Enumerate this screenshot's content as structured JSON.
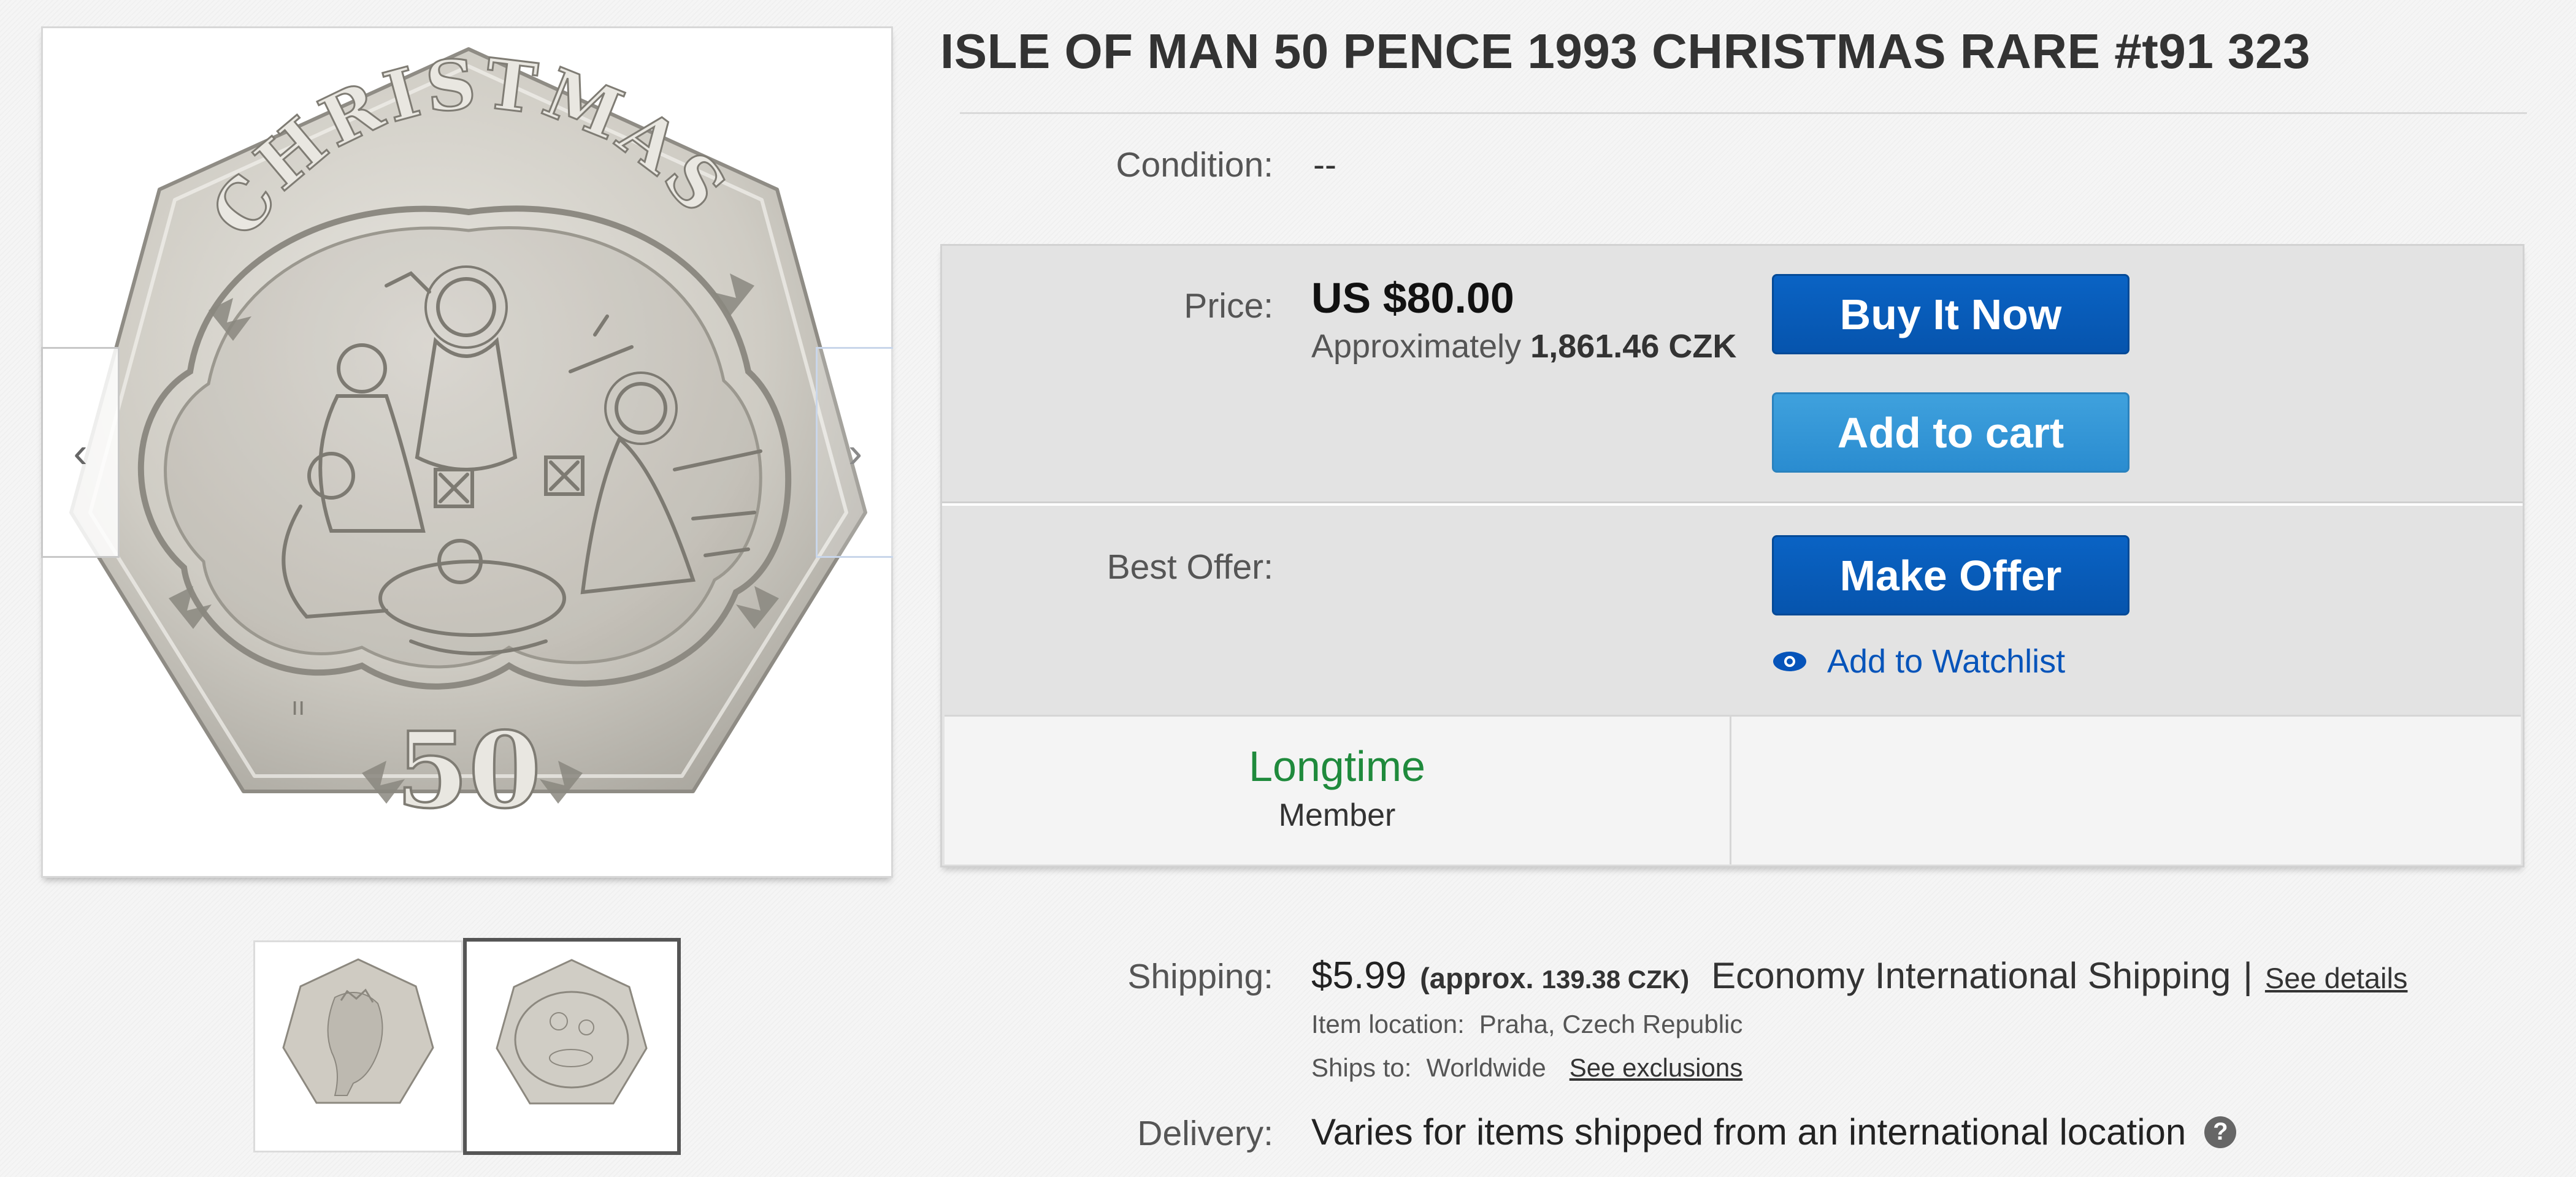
{
  "viewer": {
    "prev_icon": "chevron-left-icon",
    "next_icon": "chevron-right-icon",
    "coin": {
      "top_text": "CHRISTMAS",
      "value_text": "50",
      "mint_marks": "ıı"
    },
    "thumbnails": [
      {
        "name": "coin-obverse-thumbnail",
        "selected": false
      },
      {
        "name": "coin-reverse-thumbnail",
        "selected": true
      }
    ]
  },
  "listing": {
    "title": "ISLE OF MAN 50 PENCE 1993 CHRISTMAS RARE #t91 323",
    "condition_label": "Condition:",
    "condition_value": "--"
  },
  "buybox": {
    "price_label": "Price:",
    "price": "US $80.00",
    "approx_prefix": "Approximately",
    "approx_value": "1,861.46 CZK",
    "buy_now": "Buy It Now",
    "add_to_cart": "Add to cart",
    "best_offer_label": "Best Offer:",
    "make_offer": "Make Offer",
    "watchlist": "Add to Watchlist",
    "badge_title": "Longtime",
    "badge_subtitle": "Member"
  },
  "shipping": {
    "label": "Shipping:",
    "price": "$5.99",
    "approx_prefix": "(approx.",
    "approx_value": "139.38 CZK)",
    "service": "Economy International Shipping",
    "separator": "|",
    "see_details": "See details",
    "location_label": "Item location:",
    "location_value": "Praha, Czech Republic",
    "ships_to_label": "Ships to:",
    "ships_to_value": "Worldwide",
    "see_exclusions": "See exclusions"
  },
  "delivery": {
    "label": "Delivery:",
    "value": "Varies for items shipped from an international location",
    "help_icon": "?"
  },
  "colors": {
    "primary_button": "#0654ad",
    "cart_button": "#2a8cd0",
    "badge_green": "#1f8a3c",
    "link_blue": "#0654ba"
  }
}
